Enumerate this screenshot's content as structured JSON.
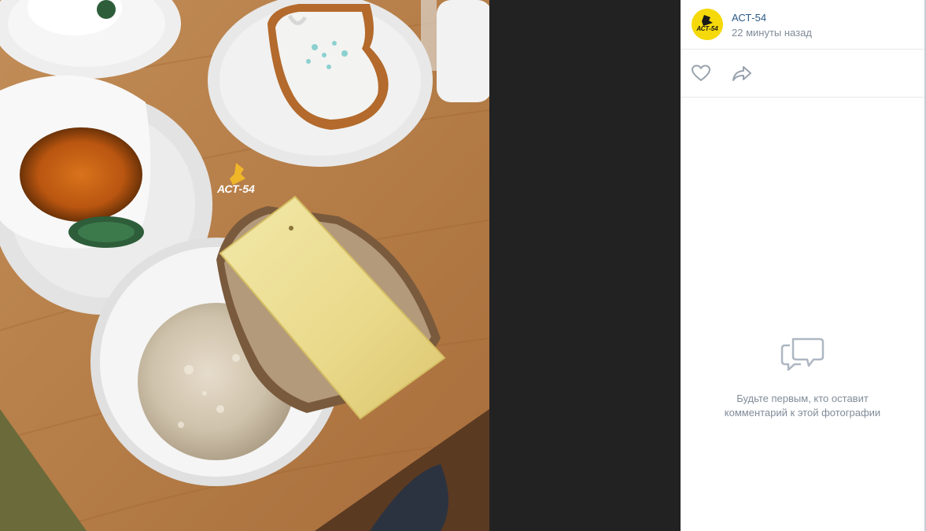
{
  "photo": {
    "description_icon": "food-photo",
    "watermark_text": "АСТ-54"
  },
  "post": {
    "author": "АСТ-54",
    "time": "22 минуты назад",
    "avatar_text": "АСТ-54"
  },
  "actions": {
    "like_icon": "heart-icon",
    "share_icon": "share-icon"
  },
  "comments": {
    "empty_icon": "speech-bubbles-icon",
    "empty_text": "Будьте первым, кто оставит комментарий к этой фотографии"
  },
  "colors": {
    "link": "#2a5885",
    "secondary": "#818c99",
    "avatar_bg": "#f5d90a",
    "dark_bg": "#222222"
  }
}
